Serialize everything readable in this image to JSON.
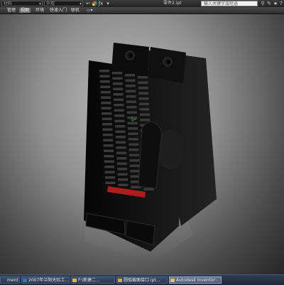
{
  "app": {
    "document_title": "零件2.ipt",
    "quick_access": {
      "material_placeholder": "材料",
      "appearance_placeholder": "外观"
    },
    "search_placeholder": "输入关键字或短语"
  },
  "ribbon_tabs": [
    {
      "label": "管理",
      "active": false
    },
    {
      "label": "视图",
      "active": true
    },
    {
      "label": "环境",
      "active": false
    },
    {
      "label": "快速入门",
      "active": false
    },
    {
      "label": "联机",
      "active": false
    }
  ],
  "taskbar": {
    "items": [
      {
        "label": "ment",
        "active": false
      },
      {
        "label": "2007年兰阳天际工…",
        "active": false
      },
      {
        "label": "F:\\新建二…",
        "active": false
      },
      {
        "label": "圆弧截面接口.ipt…",
        "active": false
      },
      {
        "label": "Autodesk Inventor…",
        "active": true
      }
    ]
  },
  "colors": {
    "model_body": "#121212",
    "release_latch": "#b01c1c",
    "viewport_background": "#9a9a9a"
  },
  "icons": [
    "return-icon",
    "undo-icon",
    "redo-icon",
    "color-wheel-icon",
    "formula-icon",
    "help-icon",
    "star-icon",
    "minimize-icon",
    "close-icon",
    "dropdown-icon"
  ]
}
